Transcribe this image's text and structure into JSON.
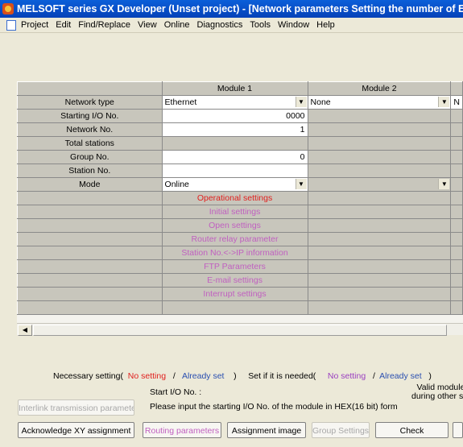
{
  "window": {
    "title": "MELSOFT series GX Developer (Unset project) - [Network parameters  Setting the number of Et"
  },
  "menu": [
    "Project",
    "Edit",
    "Find/Replace",
    "View",
    "Online",
    "Diagnostics",
    "Tools",
    "Window",
    "Help"
  ],
  "grid": {
    "col_headers": [
      "Module 1",
      "Module 2"
    ],
    "rows": {
      "network_type": {
        "label": "Network type",
        "m1": "Ethernet",
        "m2": "None",
        "m3": "N"
      },
      "start_io": {
        "label": "Starting I/O No.",
        "m1": "0000"
      },
      "network_no": {
        "label": "Network No.",
        "m1": "1"
      },
      "total_stations": {
        "label": "Total stations"
      },
      "group_no": {
        "label": "Group No.",
        "m1": "0"
      },
      "station_no": {
        "label": "Station No."
      },
      "mode": {
        "label": "Mode",
        "m1": "Online"
      }
    },
    "setting_buttons": [
      "Operational settings",
      "Initial settings",
      "Open settings",
      "Router relay parameter",
      "Station No.<->IP information",
      "FTP Parameters",
      "E-mail settings",
      "Interrupt settings"
    ]
  },
  "legend": {
    "necessary": "Necessary setting(",
    "no_setting": "No setting",
    "slash": "/",
    "already_set": "Already set",
    "close": ")",
    "if_needed": "Set if it is needed(",
    "no_setting2": "No setting",
    "slash2": "/",
    "already_set2": "Already set",
    "close2": ")"
  },
  "info": {
    "start_io_label": "Start I/O No. :",
    "prompt": "Please input the starting I/O No. of the module in HEX(16 bit) form",
    "valid_line1": "Valid module",
    "valid_line2": "during other sta"
  },
  "buttons": {
    "interlink": "Interlink transmission parameters",
    "ack_xy": "Acknowledge XY assignment",
    "routing": "Routing parameters",
    "assignment_image": "Assignment image",
    "group_settings": "Group Settings",
    "check": "Check"
  },
  "colors": {
    "necessary": "#e0201e",
    "already": "#2a4fb0",
    "optional": "#9a3fc0",
    "title_bar": "#0b5fd9"
  }
}
